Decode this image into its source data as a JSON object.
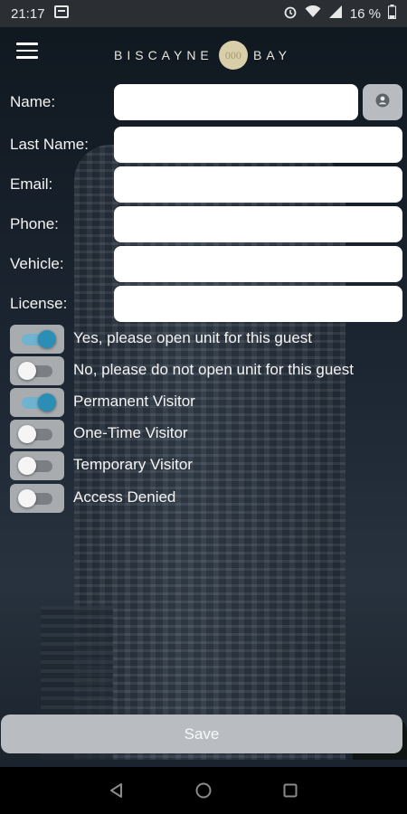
{
  "status_bar": {
    "time": "21:17",
    "battery": "16 %",
    "icons": [
      "notification-icon",
      "alarm-icon",
      "wifi-icon",
      "signal-icon",
      "battery-icon"
    ]
  },
  "app_bar": {
    "logo_left": "BISCAYNE",
    "logo_badge": "000",
    "logo_right": "BAY",
    "icons": [
      "menu-icon"
    ]
  },
  "form": {
    "fields": [
      {
        "label": "Name:",
        "value": ""
      },
      {
        "label": "Last Name:",
        "value": ""
      },
      {
        "label": "Email:",
        "value": ""
      },
      {
        "label": "Phone:",
        "value": ""
      },
      {
        "label": "Vehicle:",
        "value": ""
      },
      {
        "label": "License:",
        "value": ""
      }
    ],
    "contact_button_icon": "contact-icon"
  },
  "toggles": [
    {
      "label": "Yes, please open unit for this guest",
      "on": true
    },
    {
      "label": "No, please do not open unit for this guest",
      "on": false
    },
    {
      "label": "Permanent Visitor",
      "on": true
    },
    {
      "label": "One-Time Visitor",
      "on": false
    },
    {
      "label": "Temporary Visitor",
      "on": false
    },
    {
      "label": "Access Denied",
      "on": false
    }
  ],
  "save_label": "Save",
  "nav": {
    "icons": [
      "back-icon",
      "home-icon",
      "recents-icon"
    ]
  },
  "colors": {
    "accent": "#2a8eb5",
    "button": "#b9bdc1"
  }
}
